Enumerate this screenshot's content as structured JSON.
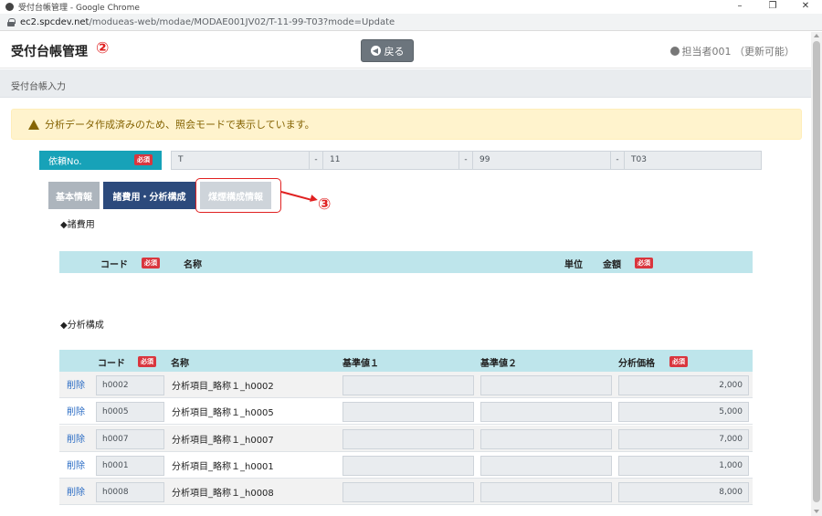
{
  "browser": {
    "window_title": "受付台帳管理 - Google Chrome",
    "url_domain": "ec2.spcdev.net",
    "url_path": "/modueas-web/modae/MODAE001JV02/T-11-99-T03?mode=Update",
    "controls": [
      "–",
      "❐",
      "✕"
    ]
  },
  "header": {
    "title": "受付台帳管理",
    "annotation": "②",
    "back_label": "戻る",
    "user_label": "担当者001 （更新可能）"
  },
  "subheader": {
    "title": "受付台帳入力"
  },
  "warning": {
    "text": "分析データ作成済みのため、照会モードで表示しています。"
  },
  "request": {
    "label": "依頼No.",
    "required": "必須",
    "parts": [
      "T",
      "11",
      "99",
      "T03"
    ],
    "separator": "-"
  },
  "tabs": [
    {
      "label": "基本情報"
    },
    {
      "label": "諸費用・分析構成"
    },
    {
      "label": "煤煙構成情報"
    }
  ],
  "tab_annotation": "③",
  "fees": {
    "section_title": "◆諸費用",
    "headers": {
      "code": "コード",
      "name": "名称",
      "unit": "単位",
      "amount": "金額"
    },
    "required": "必須"
  },
  "analysis": {
    "section_title": "◆分析構成",
    "headers": {
      "code": "コード",
      "name": "名称",
      "base1": "基準値１",
      "base2": "基準値２",
      "price": "分析価格"
    },
    "required": "必須",
    "delete_label": "削除",
    "rows": [
      {
        "code": "h0002",
        "name": "分析項目_略称１_h0002",
        "price": "2,000"
      },
      {
        "code": "h0005",
        "name": "分析項目_略称１_h0005",
        "price": "5,000"
      },
      {
        "code": "h0007",
        "name": "分析項目_略称１_h0007",
        "price": "7,000"
      },
      {
        "code": "h0001",
        "name": "分析項目_略称１_h0001",
        "price": "1,000"
      },
      {
        "code": "h0008",
        "name": "分析項目_略称１_h0008",
        "price": "8,000"
      }
    ]
  }
}
